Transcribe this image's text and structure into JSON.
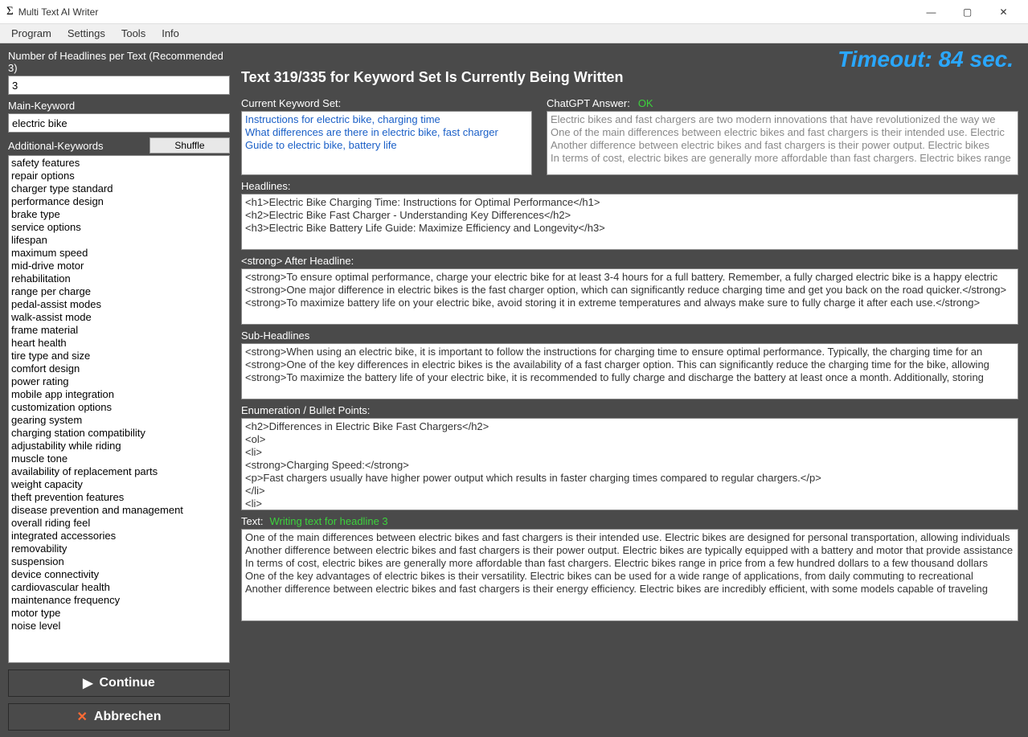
{
  "window": {
    "title": "Multi Text AI Writer"
  },
  "menu": {
    "program": "Program",
    "settings": "Settings",
    "tools": "Tools",
    "info": "Info"
  },
  "timeout": "Timeout: 84 sec.",
  "left": {
    "headlines_label": "Number of Headlines per Text (Recommended 3)",
    "headlines_value": "3",
    "mainkw_label": "Main-Keyword",
    "mainkw_value": "electric bike",
    "addkw_label": "Additional-Keywords",
    "shuffle": "Shuffle",
    "keywords": [
      "safety features",
      "repair options",
      "charger type standard",
      "performance design",
      "brake type",
      "service options",
      "lifespan",
      "maximum speed",
      "mid-drive motor",
      "rehabilitation",
      "range per charge",
      "pedal-assist modes",
      "walk-assist mode",
      "frame material",
      "heart health",
      "tire type and size",
      "comfort design",
      "power rating",
      "mobile app integration",
      "customization options",
      "gearing system",
      "charging station compatibility",
      "adjustability while riding",
      "muscle tone",
      "availability of replacement parts",
      "weight capacity",
      "theft prevention features",
      "disease prevention and management",
      "overall riding feel",
      "integrated accessories",
      "removability",
      "suspension",
      "device connectivity",
      "cardiovascular health",
      "maintenance frequency",
      "motor type",
      "noise level"
    ],
    "continue": "Continue",
    "abort": "Abbrechen"
  },
  "right": {
    "status": "Text 319/335 for Keyword Set Is Currently Being Written",
    "cks_label": "Current Keyword Set:",
    "cks_lines": [
      "Instructions for electric bike, charging time",
      "What differences are there in electric bike, fast charger",
      "Guide to electric bike, battery life"
    ],
    "ans_label": "ChatGPT Answer:",
    "ans_status": "OK",
    "ans_lines": [
      "Electric bikes and fast chargers are two modern innovations that have revolutionized the way we",
      "One of the main differences between electric bikes and fast chargers is their intended use. Electric",
      "Another difference between electric bikes and fast chargers is their power output. Electric bikes",
      "In terms of cost, electric bikes are generally more affordable than fast chargers. Electric bikes range"
    ],
    "hl_label": "Headlines:",
    "hl_lines": [
      "<h1>Electric Bike Charging Time: Instructions for Optimal Performance</h1>",
      "<h2>Electric Bike Fast Charger - Understanding Key Differences</h2>",
      "<h3>Electric Bike Battery Life Guide: Maximize Efficiency and Longevity</h3>"
    ],
    "strong_label": "<strong> After Headline:",
    "strong_lines": [
      "<strong>To ensure optimal performance, charge your electric bike for at least 3-4 hours for a full battery. Remember, a fully charged electric bike is a happy electric",
      "<strong>One major difference in electric bikes is the fast charger option, which can significantly reduce charging time and get you back on the road quicker.</strong>",
      "<strong>To maximize battery life on your electric bike, avoid storing it in extreme temperatures and always make sure to fully charge it after each use.</strong>"
    ],
    "sub_label": "Sub-Headlines",
    "sub_lines": [
      "<strong>When using an electric bike, it is important to follow the instructions for charging time to ensure optimal performance. Typically, the charging time for an",
      "<strong>One of the key differences in electric bikes is the availability of a fast charger option. This can significantly reduce the charging time for the bike, allowing",
      "<strong>To maximize the battery life of your electric bike, it is recommended to fully charge and discharge the battery at least once a month. Additionally, storing"
    ],
    "enum_label": "Enumeration / Bullet Points:",
    "enum_lines": [
      "<h2>Differences in Electric Bike Fast Chargers</h2>",
      "<ol>",
      "<li>",
      "<strong>Charging Speed:</strong>",
      "<p>Fast chargers usually have higher power output which results in faster charging times compared to regular chargers.</p>",
      "</li>",
      "<li>"
    ],
    "text_label": "Text:",
    "text_status": "Writing text for headline 3",
    "text_lines": [
      "One of the main differences between electric bikes and fast chargers is their intended use. Electric bikes are designed for personal transportation, allowing individuals",
      "Another difference between electric bikes and fast chargers is their power output. Electric bikes are typically equipped with a battery and motor that provide assistance",
      "In terms of cost, electric bikes are generally more affordable than fast chargers. Electric bikes range in price from a few hundred dollars to a few thousand dollars",
      "One of the key advantages of electric bikes is their versatility. Electric bikes can be used for a wide range of applications, from daily commuting to recreational",
      "Another difference between electric bikes and fast chargers is their energy efficiency. Electric bikes are incredibly efficient, with some models capable of traveling"
    ]
  }
}
